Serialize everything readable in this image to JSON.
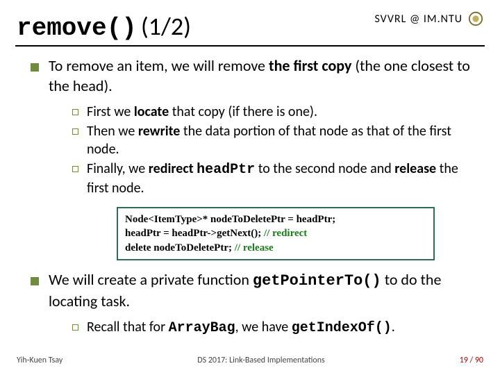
{
  "header": {
    "title_code": "remove()",
    "title_suffix": "(1/2)",
    "right_text": "SVVRL @ IM.NTU"
  },
  "main": {
    "item1": {
      "pre": "To remove an item, we will remove ",
      "bold": "the first copy",
      "post": " (the one closest to the head)."
    },
    "sub": {
      "a": {
        "p1": "First we ",
        "b1": "locate",
        "p2": " that copy (if there is one)."
      },
      "b": {
        "p1": "Then we ",
        "b1": "rewrite",
        "p2": " the data portion of that node as that of the first node."
      },
      "c": {
        "p1": "Finally, we ",
        "b1": "redirect",
        "p2": " ",
        "m1": "headPtr",
        "p3": " to the second node and ",
        "b2": "release",
        "p4": " the first node."
      }
    },
    "code": {
      "l1a": "Node<ItemType>* nodeToDeletePtr = headPtr;",
      "l2a": "headPtr = headPtr->getNext(); ",
      "l2c": "// redirect",
      "l3a": "delete nodeToDeletePtr; ",
      "l3c": "// release"
    },
    "item2": {
      "pre": "We will create a private function ",
      "mono": "getPointerTo()",
      "post": " to do the locating task."
    },
    "sub2": {
      "p1": "Recall that for ",
      "m1": "ArrayBag",
      "p2": ", we have ",
      "m2": "getIndexOf()",
      "p3": "."
    }
  },
  "footer": {
    "left": "Yih-Kuen Tsay",
    "center": "DS 2017: Link-Based Implementations",
    "right": "19 / 90"
  }
}
